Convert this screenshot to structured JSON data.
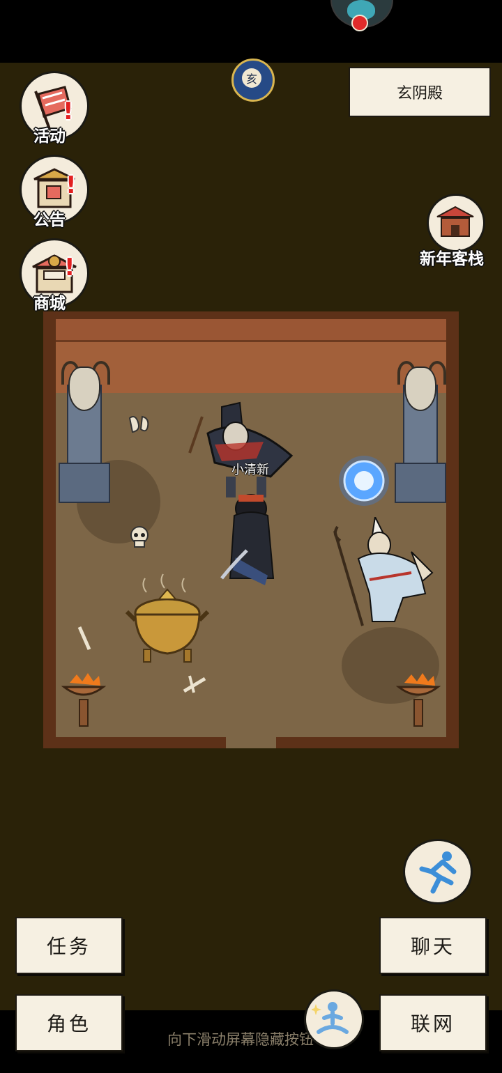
{
  "location_title": "玄阴殿",
  "hour_badge": "亥",
  "side_menu": [
    {
      "label": "活动",
      "icon": "activity-scroll-icon"
    },
    {
      "label": "公告",
      "icon": "notice-board-icon"
    },
    {
      "label": "商城",
      "icon": "shop-stall-icon"
    }
  ],
  "inn_button": {
    "label": "新年客栈",
    "icon": "inn-building-icon"
  },
  "player_name": "小清新",
  "actions": {
    "quest": "任务",
    "character": "角色",
    "chat": "聊天",
    "network": "联网"
  },
  "hint_text": "向下滑动屏幕隐藏按钮",
  "colors": {
    "background": "#2a2208",
    "paper": "#f6f0e2",
    "room_wall": "#a2603a",
    "room_floor": "#7d6647",
    "alert": "#e22020"
  }
}
